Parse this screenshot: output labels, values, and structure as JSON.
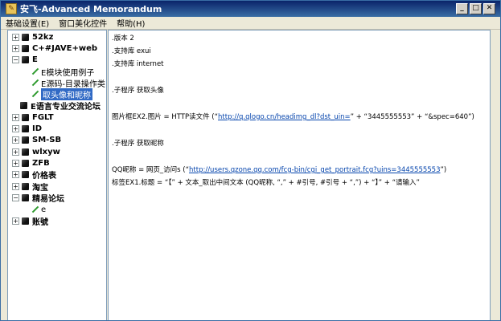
{
  "window": {
    "title": "安飞-Advanced Memorandum"
  },
  "titlebar_buttons": {
    "minimize": "_",
    "maximize": "□",
    "close": "✕"
  },
  "menu": [
    "基础设置(E)",
    "窗口美化控件",
    "帮助(H)"
  ],
  "tree": {
    "n52kz": "52kz",
    "cjava": "C+#JAVE+web",
    "e": "E",
    "e_child1": "E模块使用例子",
    "e_child2": "E源码-目录操作类",
    "e_child3": "取头像和昵称",
    "elang": "E语言专业交流论坛",
    "fglt": "FGLT",
    "id": "ID",
    "smsb": "SM-SB",
    "wlxyw": "wlxyw",
    "zfb": "ZFB",
    "price": "价格表",
    "taobao": "淘宝",
    "jingyi": "精易论坛",
    "jingyi_child": "e",
    "ledger": "账號"
  },
  "editor": {
    "l1": ".版本 2",
    "l2": ".支持库 exui",
    "l3": ".支持库 internet",
    "l4": ".子程序 获取头像",
    "l5_pre": "图片框EX2.图片 = HTTP读文件 (“",
    "l5_url": "http://q.qlogo.cn/headimg_dl?dst_uin=",
    "l5_post": "” + “3445555553” + “&spec=640”)",
    "l6": ".子程序 获取昵称",
    "l7_pre": "QQ昵称 = 网页_访问s (“",
    "l7_url": "http://users.qzone.qq.com/fcg-bin/cgi_get_portrait.fcg?uins=3445555553",
    "l7_post": "”)",
    "l8": "标签EX1.标题 = “【” + 文本_取出中间文本 (QQ昵称, “,” + #引号, #引号 + “,”) + “】” + “请输入”"
  }
}
